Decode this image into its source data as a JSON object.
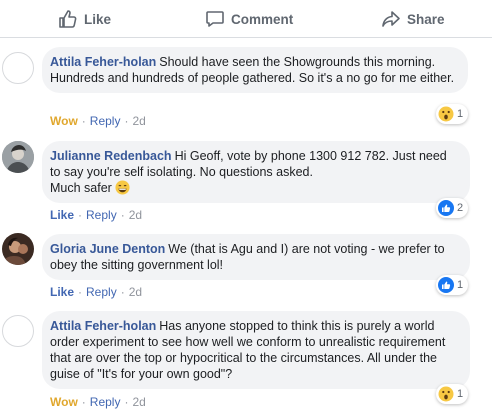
{
  "actions": {
    "like": "Like",
    "comment": "Comment",
    "share": "Share"
  },
  "comments": [
    {
      "author": "Attila Feher-holan",
      "text": "Should have seen the Showgrounds this morning. Hundreds and hundreds of people gathered. So it's a no go for me either.",
      "reaction_label": "Wow",
      "reply_label": "Reply",
      "time": "2d",
      "reaction_icon": "wow-icon",
      "reaction_count": "1"
    },
    {
      "author": "Julianne Redenbach",
      "text_line1": "Hi Geoff, vote by phone 1300 912 782. Just need to say you're self isolating. No questions asked.",
      "text_line2": "Much safer",
      "reaction_label": "Like",
      "reply_label": "Reply",
      "time": "2d",
      "reaction_icon": "like-icon",
      "reaction_count": "2"
    },
    {
      "author": "Gloria June Denton",
      "text": "We (that is Agu and I) are not voting - we prefer to obey the sitting government lol!",
      "reaction_label": "Like",
      "reply_label": "Reply",
      "time": "2d",
      "reaction_icon": "like-icon",
      "reaction_count": "1"
    },
    {
      "author": "Attila Feher-holan",
      "text": "Has anyone stopped to think this is purely a world order experiment to see how well we conform to unrealistic requirement that are over the top or hypocritical to the circumstances. All under the guise of \"It's for your own good\"?",
      "reaction_label": "Wow",
      "reply_label": "Reply",
      "time": "2d",
      "reaction_icon": "wow-icon",
      "reaction_count": "1"
    }
  ],
  "colors": {
    "link": "#385898",
    "like_blue": "#4267b2",
    "wow": "#e0a72d",
    "bubble": "#f2f3f5"
  }
}
